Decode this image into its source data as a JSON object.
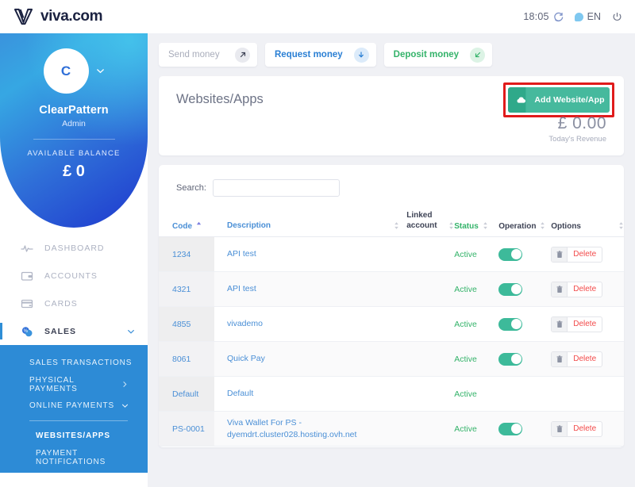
{
  "topbar": {
    "brand": "viva.com",
    "time": "18:05",
    "refresh_icon": "refresh-icon",
    "language": "EN",
    "language_icon": "globe-icon",
    "power_icon": "power-icon"
  },
  "sidebar": {
    "avatar_letter": "C",
    "account_name": "ClearPattern",
    "account_role": "Admin",
    "balance_label": "AVAILABLE BALANCE",
    "balance_value": "£ 0",
    "nav": [
      {
        "label": "DASHBOARD",
        "icon": "pulse-icon",
        "active": false,
        "chevron": false
      },
      {
        "label": "ACCOUNTS",
        "icon": "wallet-icon",
        "active": false,
        "chevron": false
      },
      {
        "label": "CARDS",
        "icon": "card-icon",
        "active": false,
        "chevron": false
      },
      {
        "label": "SALES",
        "icon": "sales-icon",
        "active": true,
        "chevron": true
      }
    ],
    "submenu": [
      {
        "label": "SALES TRANSACTIONS",
        "chevron": "none",
        "strong": false,
        "indent": false
      },
      {
        "label": "PHYSICAL PAYMENTS",
        "chevron": "right",
        "strong": false,
        "indent": false
      },
      {
        "label": "ONLINE PAYMENTS",
        "chevron": "down",
        "strong": false,
        "indent": false
      },
      {
        "label": "WEBSITES/APPS",
        "chevron": "none",
        "strong": true,
        "indent": true
      },
      {
        "label": "PAYMENT NOTIFICATIONS",
        "chevron": "none",
        "strong": false,
        "indent": true
      }
    ]
  },
  "actions": [
    {
      "label": "Send money",
      "icon": "arrow-up-right-icon",
      "style": "send"
    },
    {
      "label": "Request money",
      "icon": "arrow-down-icon",
      "style": "request"
    },
    {
      "label": "Deposit money",
      "icon": "arrow-down-left-icon",
      "style": "deposit"
    }
  ],
  "header": {
    "title": "Websites/Apps",
    "add_button_label": "Add Website/App",
    "add_button_icon": "cloud-icon",
    "add_button_color": "#46b99d",
    "highlight_color": "#e01b1b",
    "revenue_amount": "£ 0.00",
    "revenue_caption": "Today's Revenue"
  },
  "table": {
    "search_label": "Search:",
    "search_value": "",
    "search_placeholder": "",
    "columns": [
      {
        "label": "Code",
        "sort": "asc"
      },
      {
        "label": "Description",
        "sort": "both"
      },
      {
        "label": "Linked account",
        "sort": "both"
      },
      {
        "label": "Status",
        "sort": "both"
      },
      {
        "label": "Operation",
        "sort": "both"
      },
      {
        "label": "Options",
        "sort": "both"
      }
    ],
    "rows": [
      {
        "code": "1234",
        "description": "API test",
        "linked_account": "",
        "status": "Active",
        "toggle": true,
        "delete_label": "Delete",
        "has_delete": true
      },
      {
        "code": "4321",
        "description": "API test",
        "linked_account": "",
        "status": "Active",
        "toggle": true,
        "delete_label": "Delete",
        "has_delete": true
      },
      {
        "code": "4855",
        "description": "vivademo",
        "linked_account": "",
        "status": "Active",
        "toggle": true,
        "delete_label": "Delete",
        "has_delete": true
      },
      {
        "code": "8061",
        "description": "Quick Pay",
        "linked_account": "",
        "status": "Active",
        "toggle": true,
        "delete_label": "Delete",
        "has_delete": true
      },
      {
        "code": "Default",
        "description": "Default",
        "linked_account": "",
        "status": "Active",
        "toggle": false,
        "delete_label": "",
        "has_delete": false
      },
      {
        "code": "PS-0001",
        "description": "Viva Wallet For PS - dyemdrt.cluster028.hosting.ovh.net",
        "linked_account": "",
        "status": "Active",
        "toggle": true,
        "delete_label": "Delete",
        "has_delete": true
      }
    ]
  }
}
